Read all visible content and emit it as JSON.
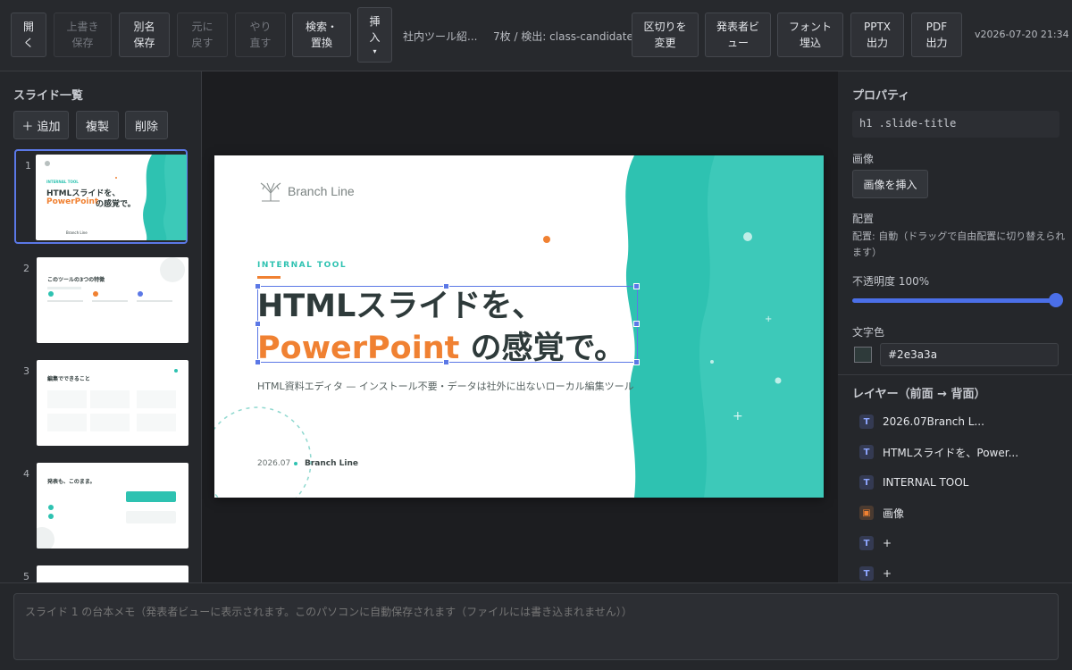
{
  "toolbar": {
    "open": "開\nく",
    "overwrite_save": "上書き\n保存",
    "save_as": "別名\n保存",
    "undo": "元に\n戻す",
    "redo": "やり\n直す",
    "search_replace": "検索・\n置換",
    "insert": "挿\n入",
    "insert_caret": "▾",
    "filename": "社内ツール紹...",
    "slide_info": "7枚 / 検出: class-candidate",
    "change_separator": "区切りを\n変更",
    "presenter_view": "発表者ビ\nュー",
    "embed_fonts": "フォント\n埋込",
    "export_pptx": "PPTX\n出力",
    "export_pdf": "PDF\n出力",
    "version": "v2026-07-20 21:34"
  },
  "slide_list": {
    "title": "スライド一覧",
    "add_label": "＋ 追加",
    "duplicate_label": "複製",
    "delete_label": "削除",
    "thumbnails": [
      {
        "num": "1",
        "title_line1": "HTMLスライドを、",
        "title_accent": "PowerPoint",
        "title_rest": " の感覚で。",
        "kicker": "INTERNAL TOOL",
        "brand": "Branch Line"
      },
      {
        "num": "2",
        "heading": "このツールの3つの特徴"
      },
      {
        "num": "3",
        "heading": "編集でできること"
      },
      {
        "num": "4",
        "heading": "発表も、このまま。"
      },
      {
        "num": "5"
      }
    ]
  },
  "slide": {
    "logo_text": "Branch Line",
    "kicker": "INTERNAL TOOL",
    "title_line1": "HTMLスライドを、",
    "title_accent": "PowerPoint",
    "title_rest": " の感覚で。",
    "subtitle": "HTML資料エディタ — インストール不要・データは社外に出ないローカル編集ツール",
    "footer_date": "2026.07",
    "footer_brand": "Branch Line"
  },
  "properties": {
    "title": "プロパティ",
    "selector": "h1 .slide-title",
    "image_label": "画像",
    "insert_image": "画像を挿入",
    "placement_label": "配置",
    "placement_hint": "配置: 自動（ドラッグで自由配置に切り替えられます）",
    "opacity_label": "不透明度 100%",
    "opacity_value": 1.0,
    "text_color_label": "文字色",
    "text_color": "#2e3a3a",
    "layers_title": "レイヤー（前面 → 背面）",
    "layers": [
      {
        "icon": "T",
        "label": "2026.07Branch L..."
      },
      {
        "icon": "T",
        "label": "HTMLスライドを、Power..."
      },
      {
        "icon": "T",
        "label": "INTERNAL TOOL"
      },
      {
        "icon": "▣",
        "label": "画像"
      },
      {
        "icon": "T",
        "label": "+"
      },
      {
        "icon": "T",
        "label": "+"
      }
    ]
  },
  "notes": {
    "placeholder": "スライド 1 の台本メモ（発表者ビューに表示されます。このパソコンに自動保存されます（ファイルには書き込まれません））"
  },
  "colors": {
    "accent_teal": "#2ec2b1",
    "accent_orange": "#f08132",
    "selection_blue": "#5b78e6"
  }
}
